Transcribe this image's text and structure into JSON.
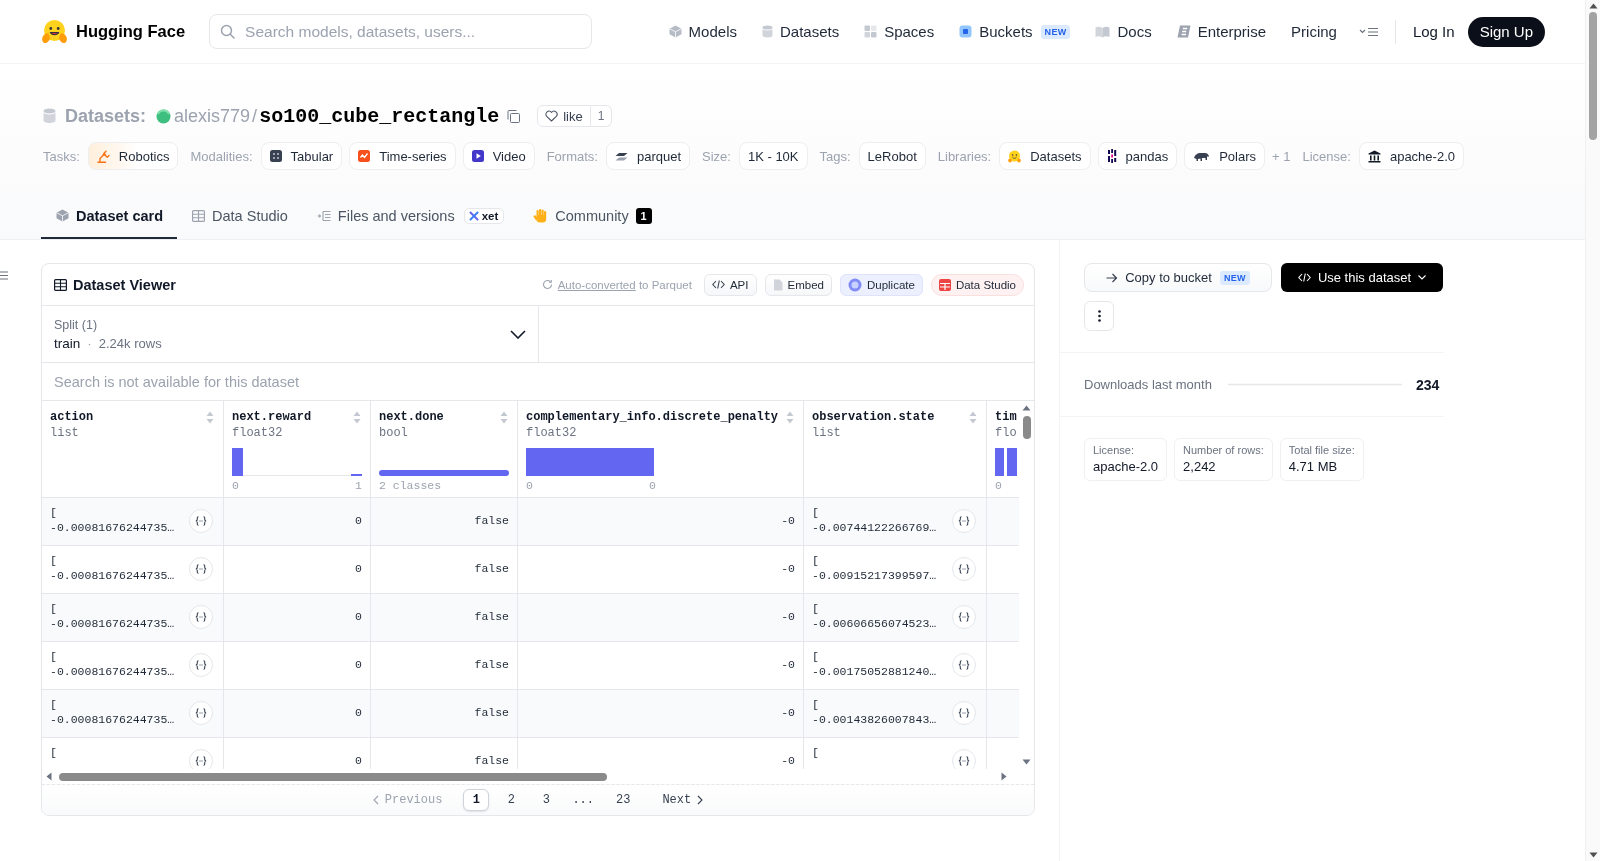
{
  "nav": {
    "brand": "Hugging Face",
    "search": {
      "placeholder": "Search models, datasets, users..."
    },
    "links": [
      {
        "label": "Models"
      },
      {
        "label": "Datasets"
      },
      {
        "label": "Spaces"
      },
      {
        "label": "Buckets",
        "badge": "NEW"
      },
      {
        "label": "Docs"
      },
      {
        "label": "Enterprise"
      },
      {
        "label": "Pricing"
      }
    ],
    "log_in": "Log In",
    "sign_up": "Sign Up"
  },
  "header": {
    "section": "Datasets:",
    "owner": "alexis779",
    "separator": "/",
    "name": "so100_cube_rectangle",
    "like": {
      "label": "like",
      "count": "1"
    },
    "tag_groups": [
      {
        "label": "Tasks:",
        "tags": [
          "Robotics"
        ]
      },
      {
        "label": "Modalities:",
        "tags": [
          "Tabular",
          "Time-series",
          "Video"
        ]
      },
      {
        "label": "Formats:",
        "tags": [
          "parquet"
        ]
      },
      {
        "label": "Size:",
        "tags": [
          "1K - 10K"
        ]
      },
      {
        "label": "Tags:",
        "tags": [
          "LeRobot"
        ]
      },
      {
        "label": "Libraries:",
        "tags": [
          "Datasets",
          "pandas",
          "Polars"
        ],
        "more": "+ 1"
      },
      {
        "label": "License:",
        "tags": [
          "apache-2.0"
        ]
      }
    ],
    "tabs": [
      {
        "label": "Dataset card",
        "selected": true
      },
      {
        "label": "Data Studio",
        "selected": false
      },
      {
        "label": "Files and versions",
        "selected": false,
        "badge": "xet"
      },
      {
        "label": "Community",
        "selected": false,
        "count": "1"
      }
    ]
  },
  "viewer": {
    "title": "Dataset Viewer",
    "conversion": {
      "link": "Auto-converted",
      "text": "to Parquet"
    },
    "actions": [
      {
        "label": "API",
        "kind": "plain"
      },
      {
        "label": "Embed",
        "kind": "plain"
      },
      {
        "label": "Duplicate",
        "kind": "soft"
      },
      {
        "label": "Data Studio",
        "kind": "warm"
      }
    ],
    "split": {
      "label": "Split (1)",
      "value": "train",
      "separator": "·",
      "rows": "2.24k rows"
    },
    "search": {
      "placeholder": "Search is not available for this dataset"
    },
    "columns": [
      {
        "name": "action",
        "type": "list",
        "kind": "list"
      },
      {
        "name": "next.reward",
        "type": "float32",
        "kind": "numeric",
        "range": [
          "0",
          "1"
        ]
      },
      {
        "name": "next.done",
        "type": "bool",
        "kind": "classes",
        "summary": "2 classes"
      },
      {
        "name": "complementary_info.discrete_penalty",
        "type": "float32",
        "kind": "numeric",
        "range": [
          "0",
          "0"
        ]
      },
      {
        "name": "observation.state",
        "type": "list",
        "kind": "list"
      },
      {
        "name": "tim",
        "type": "flo",
        "kind": "numeric",
        "range": [
          "0"
        ]
      }
    ],
    "rows": [
      [
        "[\n-0.00081676244735…",
        "0",
        "false",
        "-0",
        "[\n-0.00744122266769…"
      ],
      [
        "[\n-0.00081676244735…",
        "0",
        "false",
        "-0",
        "[\n-0.00915217399597…"
      ],
      [
        "[\n-0.00081676244735…",
        "0",
        "false",
        "-0",
        "[\n-0.00606656074523…"
      ],
      [
        "[\n-0.00081676244735…",
        "0",
        "false",
        "-0",
        "[\n-0.00175052881240…"
      ],
      [
        "[\n-0.00081676244735…",
        "0",
        "false",
        "-0",
        "[\n-0.00143826007843…"
      ],
      [
        "[",
        "0",
        "false",
        "-0",
        "["
      ]
    ],
    "pagination": {
      "previous": {
        "label": "Previous",
        "disabled": true
      },
      "pages": [
        {
          "label": "1",
          "kind": "page",
          "selected": true
        },
        {
          "label": "2",
          "kind": "page",
          "selected": false
        },
        {
          "label": "3",
          "kind": "page",
          "selected": false
        },
        {
          "label": "...",
          "kind": "gap"
        },
        {
          "label": "23",
          "kind": "page",
          "selected": false
        }
      ],
      "next": {
        "label": "Next",
        "disabled": false
      }
    }
  },
  "sidebar": {
    "copy_to_bucket": {
      "label": "Copy to bucket",
      "badge": "NEW"
    },
    "use_dataset": {
      "label": "Use this dataset"
    },
    "downloads": {
      "label": "Downloads last month",
      "value": "234"
    },
    "facts": [
      {
        "label": "License:",
        "value": "apache-2.0"
      },
      {
        "label": "Number of rows:",
        "value": "2,242"
      },
      {
        "label": "Total file size:",
        "value": "4.71 MB"
      }
    ]
  }
}
